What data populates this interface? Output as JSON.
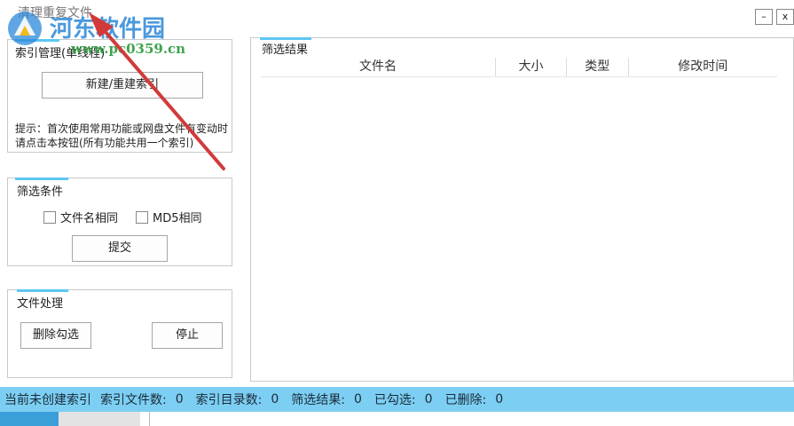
{
  "window": {
    "title": "清理重复文件",
    "minimize_label": "–",
    "close_label": "x"
  },
  "index_panel": {
    "title": "索引管理(单线程)",
    "button_label": "新建/重建索引",
    "hint_line1": "提示：首次使用常用功能或网盘文件有变动时",
    "hint_line2": "请点击本按钮(所有功能共用一个索引)"
  },
  "filter_panel": {
    "title": "筛选条件",
    "checkbox_filename": "文件名相同",
    "checkbox_md5": "MD5相同",
    "submit_label": "提交"
  },
  "file_panel": {
    "title": "文件处理",
    "delete_label": "删除勾选",
    "stop_label": "停止"
  },
  "results_panel": {
    "title": "筛选结果",
    "columns": [
      "文件名",
      "大小",
      "类型",
      "修改时间"
    ]
  },
  "status": {
    "state": "当前未创建索引",
    "index_files_label": "索引文件数:",
    "index_files_value": "0",
    "index_dirs_label": "索引目录数:",
    "index_dirs_value": "0",
    "results_label": "筛选结果:",
    "results_value": "0",
    "checked_label": "已勾选:",
    "checked_value": "0",
    "deleted_label": "已删除:",
    "deleted_value": "0"
  },
  "watermark": {
    "site_name": "河东软件园",
    "url": "www.pc0359.cn"
  },
  "colors": {
    "accent": "#5cc6f2",
    "statusbar": "#7ccff2",
    "arrow": "#d23a3a"
  }
}
